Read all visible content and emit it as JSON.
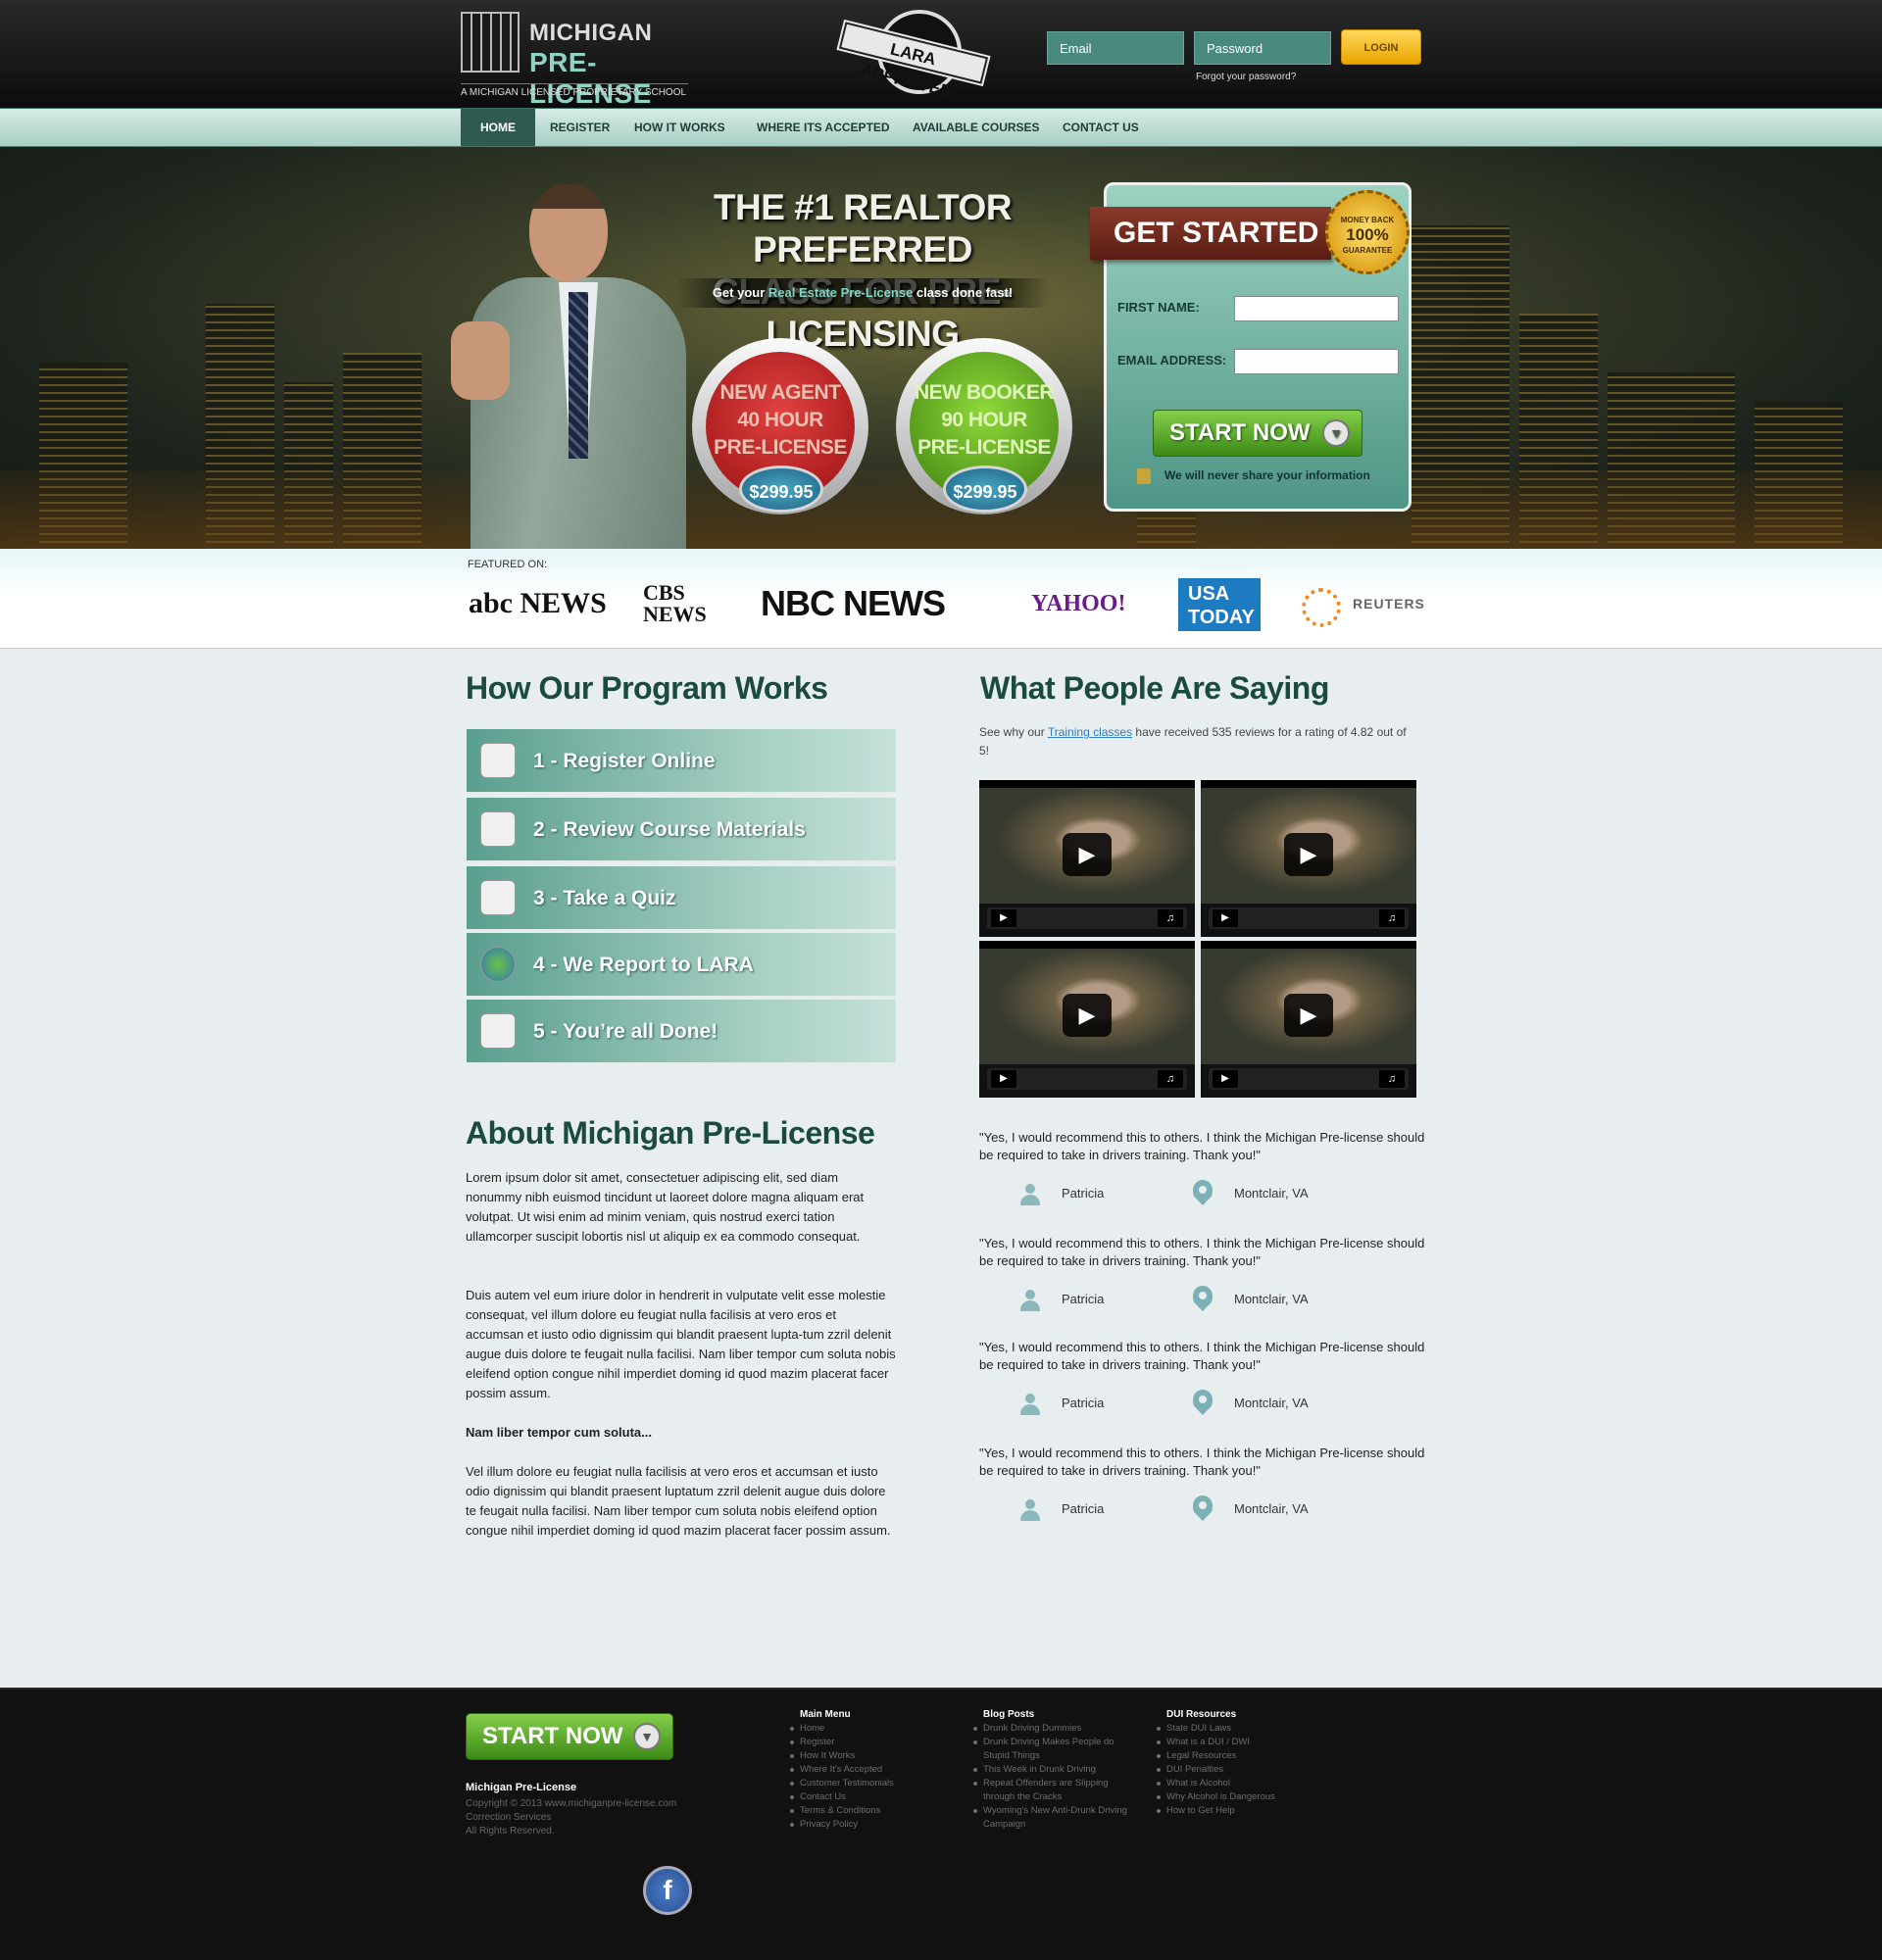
{
  "header": {
    "logo_line1": "MICHIGAN",
    "logo_line2": "PRE-LICENSE",
    "logo_tagline": "A MICHIGAN LICENSED PROPRIETARY SCHOOL",
    "lara_badge": "LARA APPROVED",
    "email_placeholder": "Email",
    "password_placeholder": "Password",
    "login_label": "LOGIN",
    "forgot_label": "Forgot your password?"
  },
  "nav": {
    "items": [
      {
        "label": "HOME",
        "active": true
      },
      {
        "label": "REGISTER"
      },
      {
        "label": "HOW IT WORKS"
      },
      {
        "label": "WHERE ITS ACCEPTED"
      },
      {
        "label": "AVAILABLE COURSES"
      },
      {
        "label": "CONTACT US"
      }
    ]
  },
  "hero": {
    "headline_line1": "THE #1 REALTOR PREFERRED",
    "headline_line2": "CLASS FOR PRE-LICENSING",
    "sub_pre": "Get your ",
    "sub_highlight": "Real Estate Pre-License",
    "sub_post": " class done fast!",
    "offers": [
      {
        "line1": "NEW AGENT",
        "line2": "40 HOUR",
        "line3": "PRE-LICENSE",
        "price": "$299.95"
      },
      {
        "line1": "NEW BOOKER",
        "line2": "90 HOUR",
        "line3": "PRE-LICENSE",
        "price": "$299.95"
      }
    ]
  },
  "signup": {
    "ribbon": "GET STARTED",
    "seal_top": "MONEY BACK",
    "seal_big": "100%",
    "seal_bottom": "GUARANTEE",
    "first_name_label": "FIRST NAME:",
    "email_label": "EMAIL ADDRESS:",
    "start_label": "START NOW",
    "privacy": "We will never share your information"
  },
  "featured": {
    "label": "FEATURED ON:",
    "logos": [
      "abc NEWS",
      "CBS NEWS",
      "NBC NEWS",
      "YAHOO!",
      "USA TODAY",
      "REUTERS"
    ]
  },
  "program": {
    "title": "How Our Program Works",
    "steps": [
      "1 - Register Online",
      "2 - Review Course Materials",
      "3 - Take a Quiz",
      "4 - We Report to LARA",
      "5 - You’re all Done!"
    ]
  },
  "about": {
    "title": "About Michigan Pre-License",
    "p1": "Lorem ipsum dolor sit amet, consectetuer adipiscing elit, sed diam nonummy nibh euismod tincidunt ut laoreet dolore magna aliquam erat volutpat. Ut wisi enim ad minim veniam, quis nostrud exerci tation ullamcorper suscipit lobortis nisl ut aliquip ex ea commodo consequat.",
    "p2": "Duis autem vel eum iriure dolor in hendrerit in vulputate velit esse molestie consequat, vel illum dolore eu feugiat nulla facilisis at vero eros et accumsan et iusto odio dignissim qui blandit praesent lupta-tum zzril delenit augue duis dolore te feugait nulla facilisi. Nam liber tempor cum soluta nobis eleifend option congue nihil imperdiet doming id quod mazim placerat facer possim assum.",
    "p3": "Nam liber tempor cum soluta...",
    "p4": "Vel illum dolore eu feugiat nulla facilisis at vero eros et accumsan et iusto odio dignissim qui blandit praesent luptatum zzril delenit augue duis dolore te feugait nulla facilisi. Nam liber tempor cum soluta nobis eleifend option congue nihil imperdiet doming id quod mazim placerat facer possim assum."
  },
  "testimonials": {
    "title": "What People Are Saying",
    "intro_pre": "See why our ",
    "intro_link": "Training classes",
    "intro_post": " have received 535 reviews for a rating of 4.82 out of 5!",
    "reviews": [
      {
        "text": "\"Yes, I would recommend this to others. I think the Michigan Pre-license should be required to take in drivers training. Thank you!\"",
        "name": "Patricia",
        "location": "Montclair, VA"
      },
      {
        "text": "\"Yes, I would recommend this to others. I think the Michigan Pre-license should be required to take in drivers training. Thank you!\"",
        "name": "Patricia",
        "location": "Montclair, VA"
      },
      {
        "text": "\"Yes, I would recommend this to others. I think the Michigan Pre-license should be required to take in drivers training. Thank you!\"",
        "name": "Patricia",
        "location": "Montclair, VA"
      },
      {
        "text": "\"Yes, I would recommend this to others. I think the Michigan Pre-license should be required to take in drivers training. Thank you!\"",
        "name": "Patricia",
        "location": "Montclair, VA"
      }
    ]
  },
  "footer": {
    "start_label": "START NOW",
    "brand": "Michigan Pre-License",
    "copy1": "Copyright © 2013 www.michiganpre-license.com",
    "copy2": "Correction Services",
    "copy3": "All Rights Reserved.",
    "main_menu_title": "Main Menu",
    "main_menu": [
      "Home",
      "Register",
      "How It Works",
      "Where It's Accepted",
      "Customer Testimonials",
      "Contact Us",
      "Terms & Conditions",
      "Privacy Policy"
    ],
    "blog_title": "Blog Posts",
    "blog": [
      "Drunk Driving Dummies",
      "Drunk Driving Makes People do Stupid Things",
      "This Week in Drunk Driving",
      "Repeat Offenders are Slipping through the Cracks",
      "Wyoming's New Anti-Drunk Driving Campaign"
    ],
    "dui_title": "DUI Resources",
    "dui": [
      "State DUI Laws",
      "What is a DUI / DWI",
      "Legal Resources",
      "DUI Penalties",
      "What is Alcohol",
      "Why Alcohol is Dangerous",
      "How to Get Help"
    ],
    "social_icon": "facebook-icon"
  }
}
